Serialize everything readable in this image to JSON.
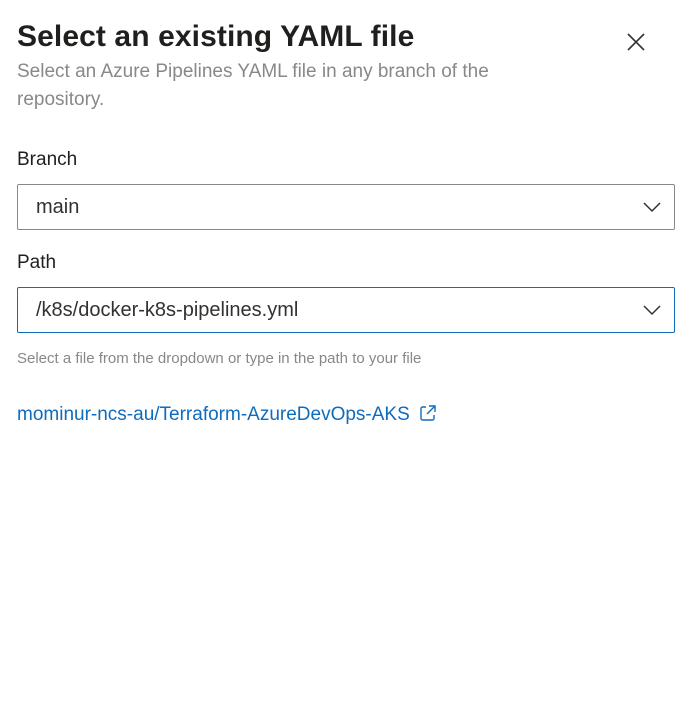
{
  "dialog": {
    "title": "Select an existing YAML file",
    "subtitle": "Select an Azure Pipelines YAML file in any branch of the repository.",
    "close_icon": "close-icon"
  },
  "branch": {
    "label": "Branch",
    "value": "main",
    "icon": "chevron-down-icon"
  },
  "path": {
    "label": "Path",
    "value": "/k8s/docker-k8s-pipelines.yml",
    "icon": "chevron-down-icon",
    "help_text": "Select a file from the dropdown or type in the path to your file"
  },
  "repository_link": {
    "text": "mominur-ncs-au/Terraform-AzureDevOps-AKS",
    "icon": "external-link-icon"
  },
  "colors": {
    "link": "#0f6cbd",
    "focus_border": "#0f6cbd",
    "secondary_text": "#8a8886",
    "primary_text": "#201f1e"
  }
}
